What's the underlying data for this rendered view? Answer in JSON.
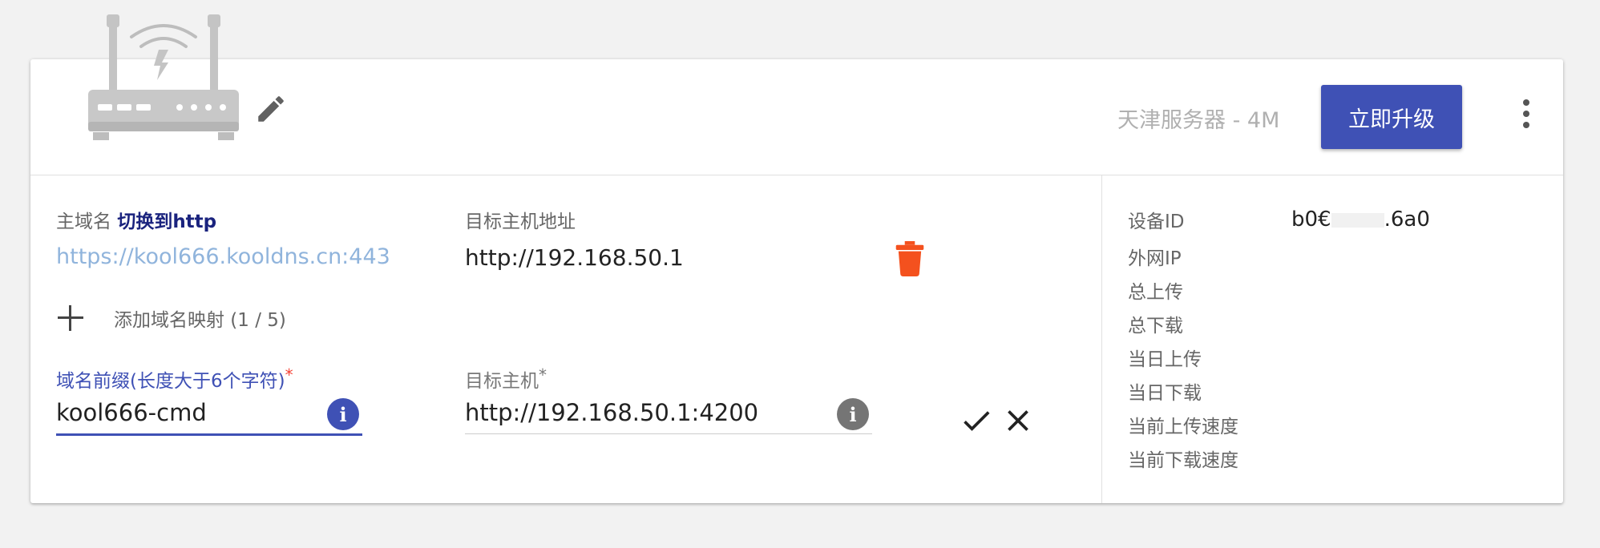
{
  "header": {
    "server_label": "天津服务器 - 4M",
    "upgrade_label": "立即升级"
  },
  "mapping": {
    "main_domain_label": "主域名",
    "switch_label": "切换到http",
    "target_host_addr_label": "目标主机地址",
    "domain_url": "https://kool666.kooldns.cn:443",
    "target_host_addr": "http://192.168.50.1",
    "add_mapping_label": "添加域名映射 (1 / 5)"
  },
  "form": {
    "prefix_label": "域名前缀(长度大于6个字符)",
    "prefix_required": "*",
    "prefix_value": "kool666-cmd",
    "target_label": "目标主机",
    "target_required": "*",
    "target_value": "http://192.168.50.1:4200"
  },
  "device": {
    "id_label": "设备ID",
    "id_prefix": "b0€",
    "id_suffix": ".6a0",
    "wan_ip_label": "外网IP",
    "total_upload_label": "总上传",
    "total_download_label": "总下载",
    "daily_upload_label": "当日上传",
    "daily_download_label": "当日下载",
    "upload_speed_label": "当前上传速度",
    "download_speed_label": "当前下载速度"
  },
  "icons": {
    "router": "router-icon",
    "edit": "pencil-icon",
    "more": "more-vert-icon",
    "delete": "trash-icon",
    "add": "plus-icon",
    "info": "info-icon",
    "confirm": "check-icon",
    "cancel": "close-icon"
  },
  "colors": {
    "primary": "#3f51b5",
    "delete": "#f4511e",
    "link": "#90b4dc",
    "required": "#f44336"
  }
}
